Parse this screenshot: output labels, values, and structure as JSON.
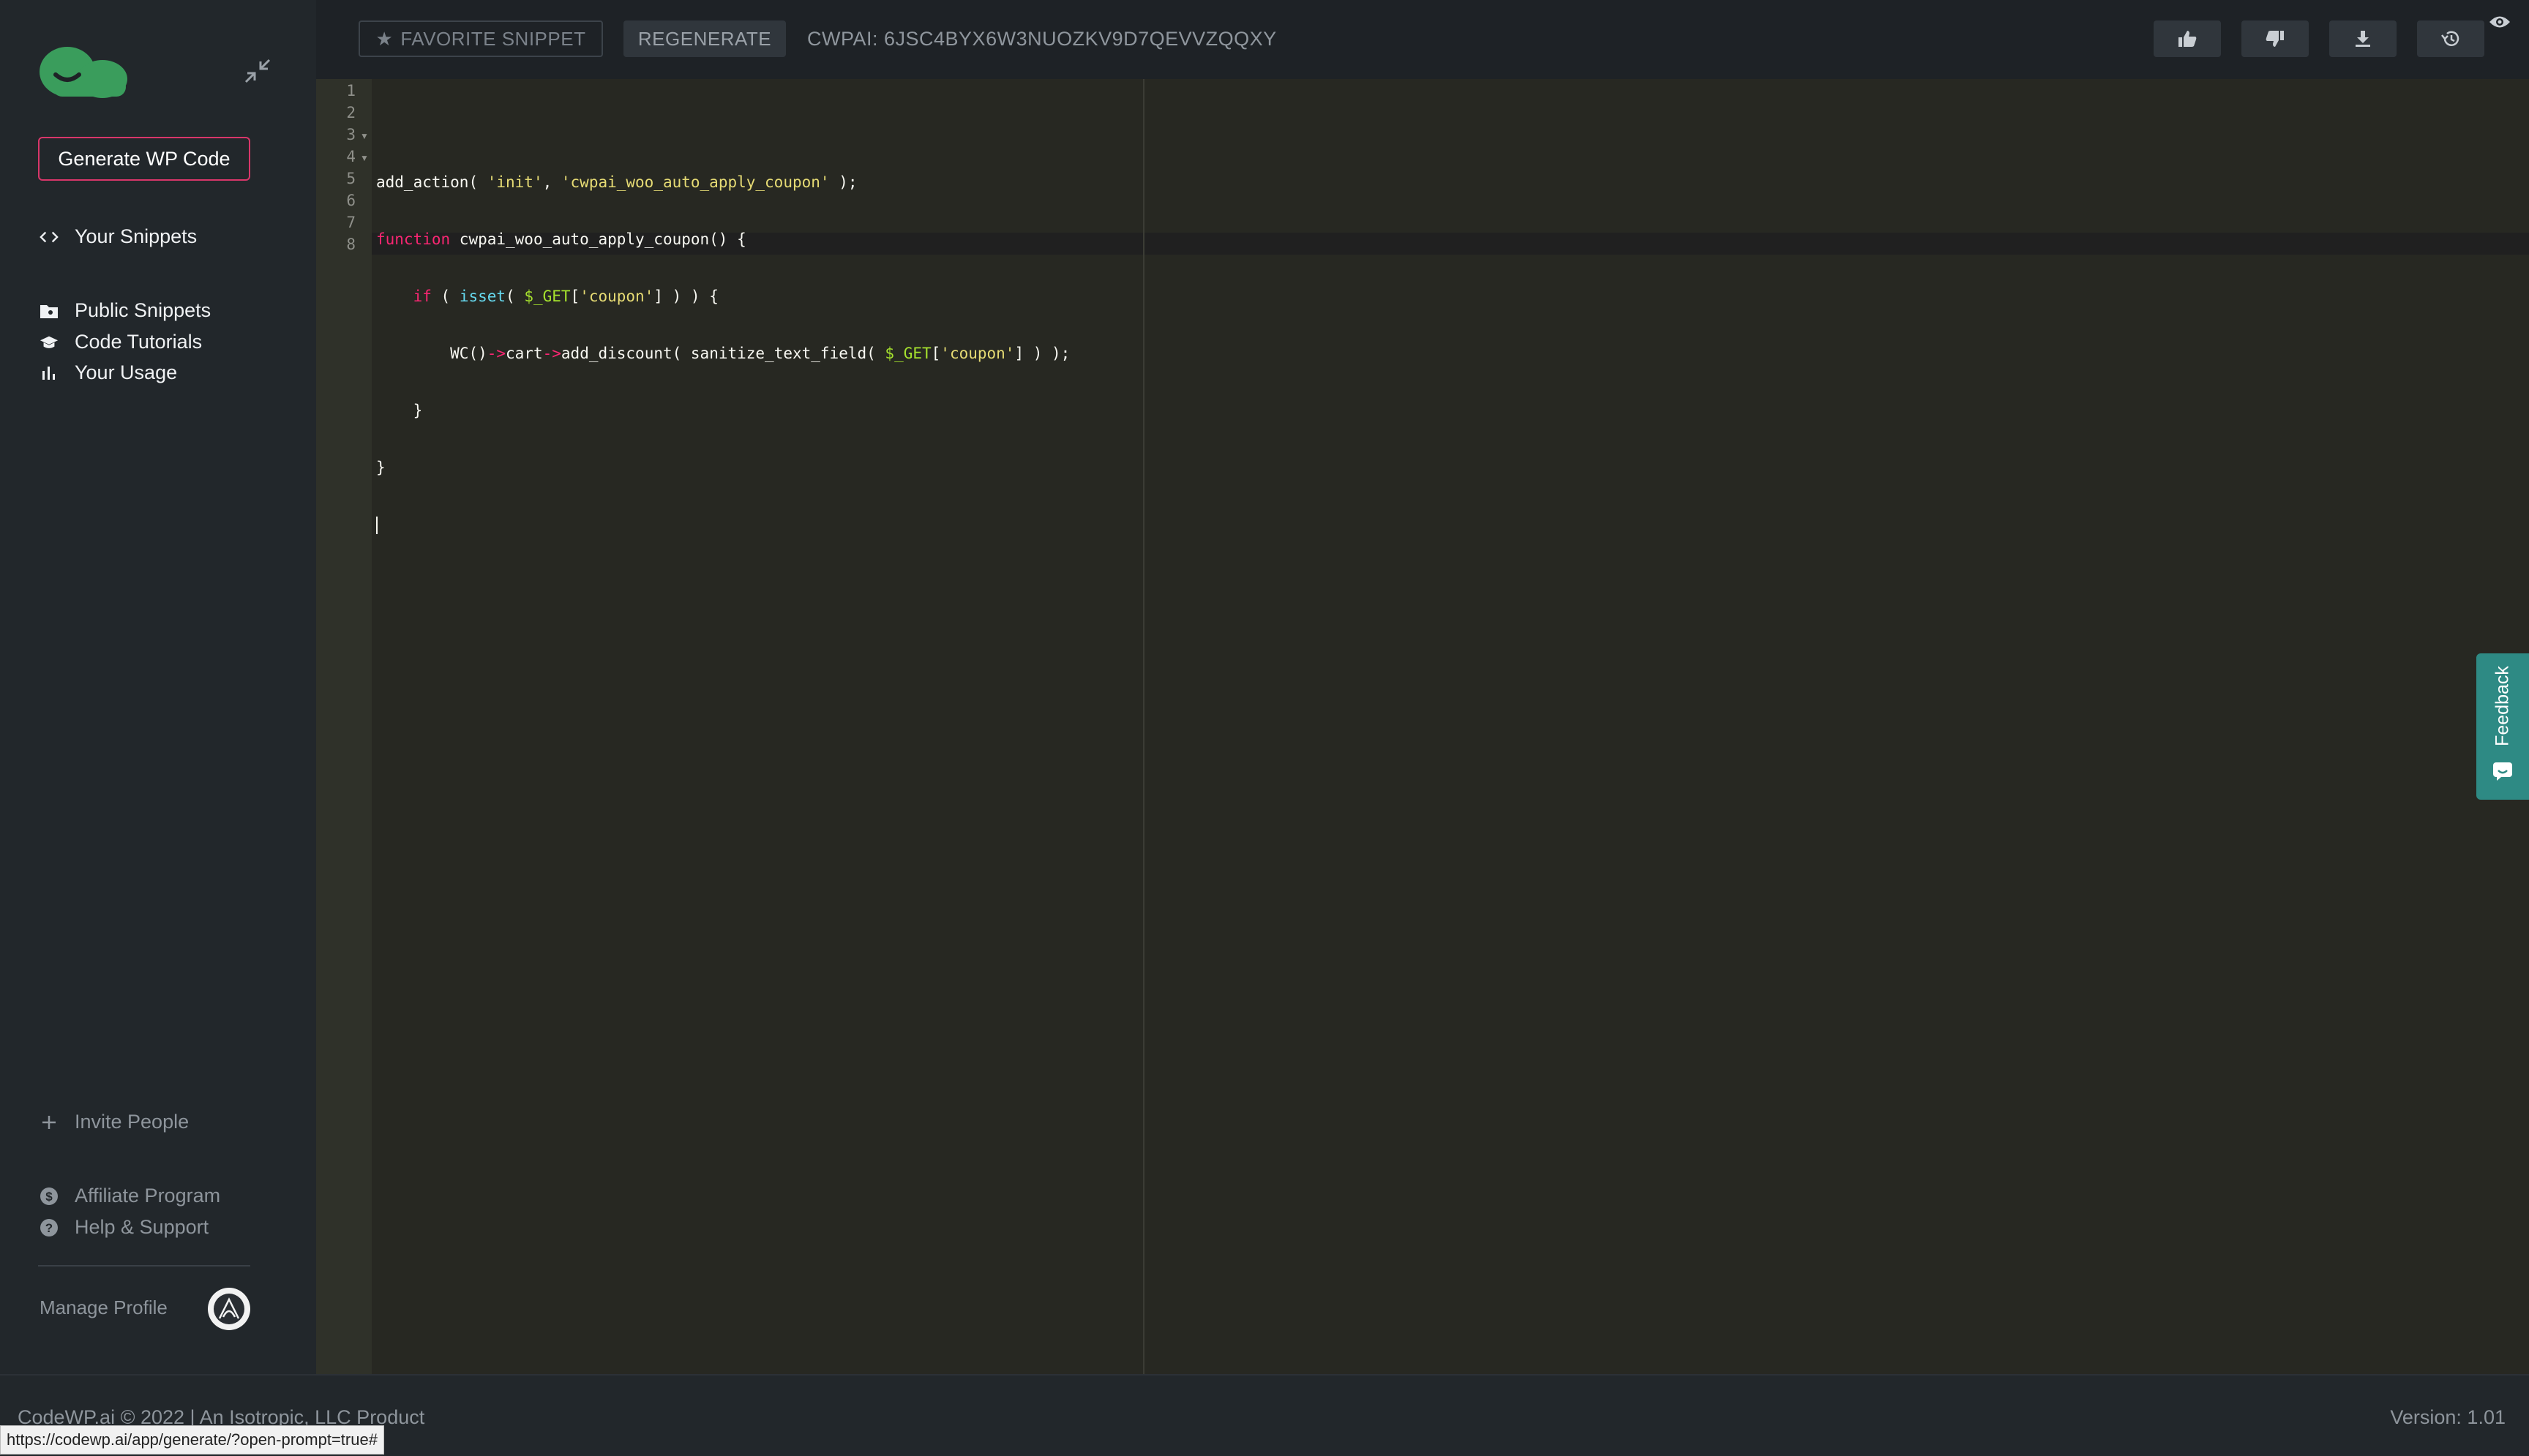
{
  "sidebar": {
    "generate_button": "Generate WP Code",
    "nav": {
      "your_snippets": "Your Snippets",
      "public_snippets": "Public Snippets",
      "code_tutorials": "Code Tutorials",
      "your_usage": "Your Usage"
    },
    "bottom": {
      "invite_people": "Invite People",
      "affiliate_program": "Affiliate Program",
      "help_support": "Help & Support",
      "manage_profile": "Manage Profile"
    }
  },
  "toolbar": {
    "favorite_label": "FAVORITE SNIPPET",
    "regenerate_label": "REGENERATE",
    "snippet_id": "CWPAI: 6JSC4BYX6W3NUOZKV9D7QEVVZQQXY",
    "icons": [
      "thumbs-up-icon",
      "thumbs-down-icon",
      "download-icon",
      "history-icon",
      "eye-icon"
    ]
  },
  "editor": {
    "line_numbers": [
      "1",
      "2",
      "3",
      "4",
      "5",
      "6",
      "7",
      "8"
    ],
    "lines": {
      "l2": {
        "fn": "add_action",
        "p1": "( ",
        "s1": "'init'",
        "c1": ", ",
        "s2": "'cwpai_woo_auto_apply_coupon'",
        "end": " );"
      },
      "l3": {
        "kw": "function",
        "name": " cwpai_woo_auto_apply_coupon() {"
      },
      "l4": {
        "indent": "    ",
        "kw": "if",
        "p1": " ( ",
        "fn": "isset",
        "p2": "( ",
        "var": "$_GET",
        "b1": "[",
        "s": "'coupon'",
        "end": "] ) ) {"
      },
      "l5": {
        "indent": "        ",
        "a": "WC()",
        "arrow1": "->",
        "b": "cart",
        "arrow2": "->",
        "c": "add_discount( sanitize_text_field( ",
        "var": "$_GET",
        "b1": "[",
        "s": "'coupon'",
        "end": "] ) );"
      },
      "l6": {
        "text": "    }"
      },
      "l7": {
        "text": "}"
      }
    },
    "colors": {
      "background": "#272822",
      "keyword": "#f92672",
      "string": "#e6db74",
      "variable": "#a6e22e"
    }
  },
  "feedback_tab": "Feedback",
  "footer": {
    "copyright": "CodeWP.ai © 2022",
    "separator": " | ",
    "company": "An Isotropic, LLC Product",
    "version": "Version: 1.01"
  },
  "status_url": "https://codewp.ai/app/generate/?open-prompt=true#",
  "colors": {
    "accent": "#d9366a",
    "brand_green": "#3a9d5c",
    "feedback": "#2e8a84"
  }
}
